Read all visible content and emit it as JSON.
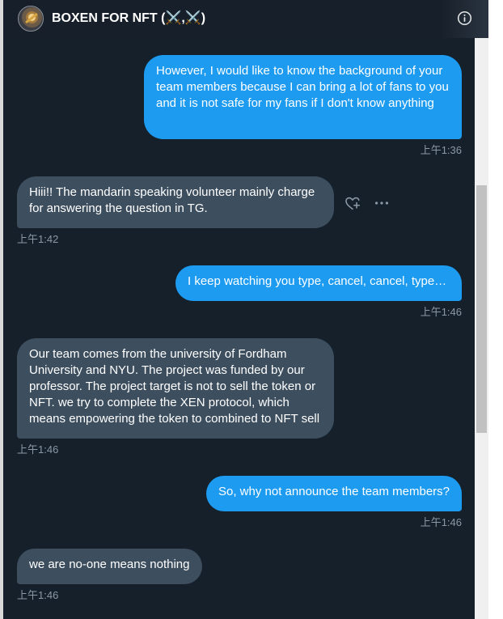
{
  "header": {
    "title": "BOXEN FOR NFT (⚔️,⚔️)",
    "avatar_icon": "nft-avatar",
    "info_icon": "info-icon"
  },
  "messages": [
    {
      "direction": "outgoing",
      "text": "However, I would like to know the background of your team members because I can bring a lot of fans to you and it is not safe for my fans if I don't know anything",
      "time": "上午1:36"
    },
    {
      "direction": "incoming",
      "text": "Hiii!! The mandarin speaking volunteer mainly charge for answering the question in TG.",
      "time": "上午1:42"
    },
    {
      "direction": "outgoing",
      "text": "I keep watching you type, cancel, cancel, type…",
      "time": "上午1:46"
    },
    {
      "direction": "incoming",
      "text": "Our team comes from the university of Fordham University and NYU.  The project was funded by our professor. The project target is not to sell the token or NFT. we try to complete the XEN protocol, which means empowering the token to combined to NFT sell",
      "time": "上午1:46"
    },
    {
      "direction": "outgoing",
      "text": "So, why not announce the team members?",
      "time": "上午1:46"
    },
    {
      "direction": "incoming",
      "text": "we are no-one means nothing",
      "time": "上午1:46"
    }
  ],
  "hover_actions": {
    "react_icon": "heart-plus-icon",
    "more_icon": "more-horizontal-icon"
  },
  "colors": {
    "background": "#15202b",
    "outgoing_bubble": "#1d9bf0",
    "incoming_bubble": "#3d4e5f",
    "timestamp": "#8b98a5"
  }
}
